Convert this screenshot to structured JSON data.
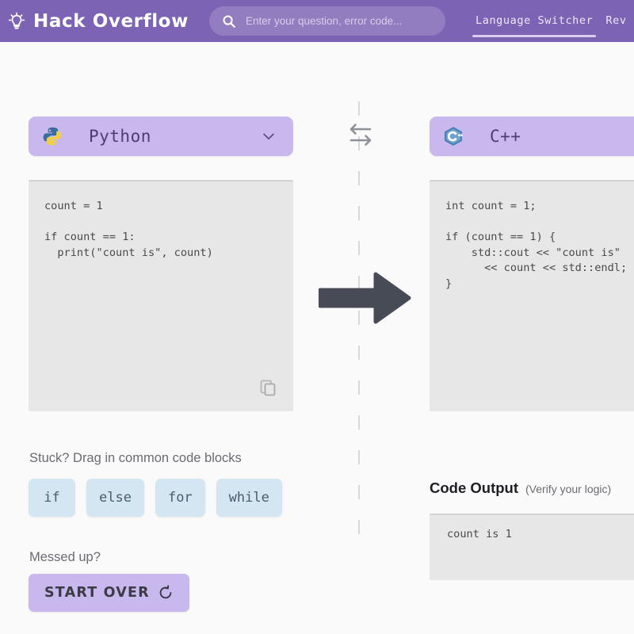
{
  "header": {
    "brand_name": "Hack Overflow",
    "logo_icon": "lightbulb-icon",
    "search": {
      "icon": "search-icon",
      "placeholder": "Enter your question, error code...",
      "value": ""
    },
    "nav_items": [
      {
        "label": "Language Switcher",
        "active": true
      },
      {
        "label": "Rev",
        "active": false
      }
    ]
  },
  "source_panel": {
    "language": "Python",
    "language_logo": "python-logo-icon",
    "dropdown_icon": "chevron-down-icon",
    "code": "count = 1\n\nif count == 1:\n  print(\"count is\", count)",
    "copy_icon": "copy-icon"
  },
  "target_panel": {
    "language": "C++",
    "language_logo": "cplusplus-logo-icon",
    "code": "int count = 1;\n\nif (count == 1) {\n    std::cout << \"count is\"\n      << count << std::endl;\n}"
  },
  "center": {
    "swap_icon": "swap-arrows-icon",
    "translate_arrow_icon": "arrow-right-icon"
  },
  "helpers": {
    "hint_label": "Stuck?  Drag in common code blocks",
    "blocks": [
      "if",
      "else",
      "for",
      "while"
    ],
    "reset_label": "Messed up?",
    "start_over_label": "START OVER",
    "reset_icon": "rotate-ccw-icon"
  },
  "output": {
    "title": "Code Output",
    "subtitle": "(Verify your logic)",
    "text": "count is 1"
  },
  "colors": {
    "header_purple": "#7C63B4",
    "accent_lavender": "#C9B8EE",
    "page_background": "#FAFAFB",
    "code_background": "#E7E7E7",
    "chip_blue": "#D3E6F1",
    "arrow_gray": "#474B55"
  }
}
